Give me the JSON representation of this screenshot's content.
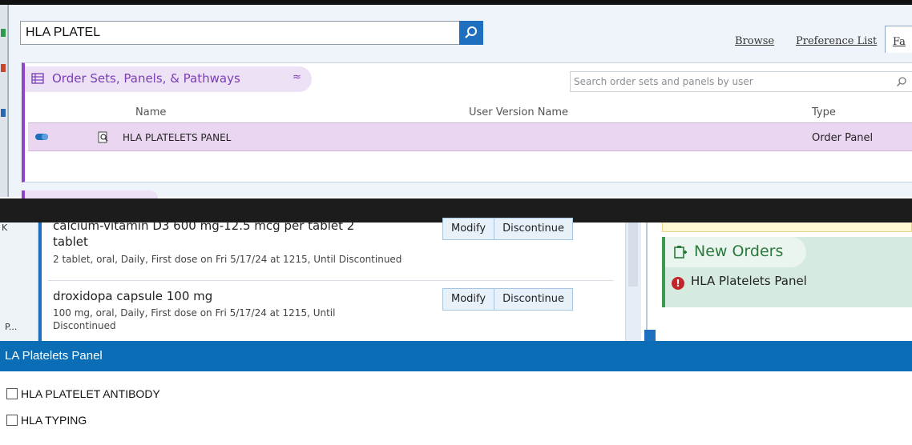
{
  "search": {
    "value": "HLA PLATEL",
    "tabs": [
      "Browse",
      "Preference List",
      "Fa"
    ]
  },
  "order_sets": {
    "title": "Order Sets, Panels, & Pathways",
    "collapse_glyph": "≈",
    "search_placeholder": "Search order sets and panels by user",
    "columns": {
      "name": "Name",
      "user_version_name": "User Version Name",
      "type": "Type"
    },
    "row": {
      "name": "HLA PLATELETS PANEL",
      "type": "Order Panel"
    }
  },
  "meds": {
    "left_edge_top": "K",
    "left_edge_bottom": "P...",
    "items": [
      {
        "name": "calcium-vitamin D3 600 mg-12.5 mcg per tablet 2",
        "name2": "tablet",
        "detail": "2 tablet, oral, Daily, First dose on Fri 5/17/24 at 1215, Until Discontinued",
        "detail2": ""
      },
      {
        "name": "droxidopa capsule 100 mg",
        "name2": "",
        "detail": "100 mg, oral, Daily, First dose on Fri 5/17/24 at 1215, Until",
        "detail2": "Discontinued"
      }
    ],
    "modify_label": "Modify",
    "discontinue_label": "Discontinue"
  },
  "new_orders": {
    "title": "New Orders",
    "item": "HLA Platelets Panel",
    "warn_glyph": "!"
  },
  "hla_panel": {
    "title": "LA Platelets Panel",
    "options": [
      "HLA PLATELET ANTIBODY",
      "HLA TYPING"
    ]
  },
  "colors": {
    "accent_blue": "#0b6db5",
    "order_set_purple": "#8e45c8",
    "new_orders_green": "#3c9a4f",
    "warning_red": "#c0272d"
  }
}
